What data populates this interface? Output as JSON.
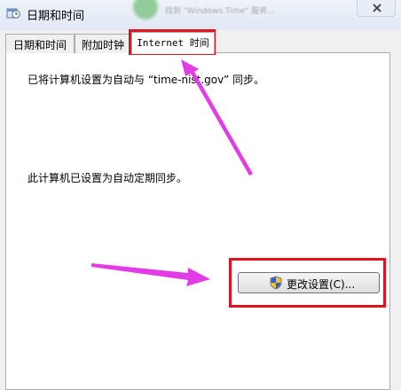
{
  "window": {
    "title": "日期和时间",
    "close_icon": "close-icon",
    "background_text": "找到 \"Windows Time\" 服务..."
  },
  "tabs": [
    {
      "label": "日期和时间",
      "active": false
    },
    {
      "label": "附加时钟",
      "active": false
    },
    {
      "label": "Internet 时间",
      "active": true
    }
  ],
  "panel": {
    "sync_text": "已将计算机设置为自动与 “time-nist.gov” 同步。",
    "schedule_text": "此计算机已设置为自动定期同步。",
    "change_button": "更改设置(C)...",
    "change_button_icon": "uac-shield-icon"
  },
  "annotations": {
    "highlight_color": "#e0141e",
    "arrow_color": "#e23ce6"
  }
}
